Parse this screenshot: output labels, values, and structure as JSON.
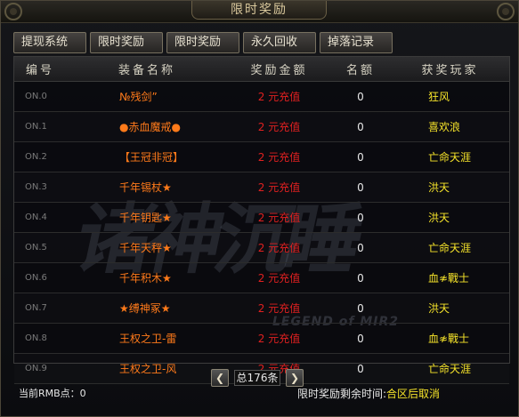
{
  "window": {
    "title": "限时奖励"
  },
  "tabs": [
    {
      "label": "提现系统"
    },
    {
      "label": "限时奖励"
    },
    {
      "label": "限时奖励"
    },
    {
      "label": "永久回收"
    },
    {
      "label": "掉落记录"
    }
  ],
  "table": {
    "headers": {
      "number": "编号",
      "item": "装备名称",
      "reward": "奖励金额",
      "quota": "名额",
      "winner": "获奖玩家"
    },
    "rows": [
      {
        "number": "ON.0",
        "item": "№残剑”",
        "reward": "2 元充值",
        "quota": "0",
        "winner": "狂风"
      },
      {
        "number": "ON.1",
        "item": "●赤血魔戒●",
        "reward": "2 元充值",
        "quota": "0",
        "winner": "喜欢浪"
      },
      {
        "number": "ON.2",
        "item": "【王冠非冠】",
        "reward": "2 元充值",
        "quota": "0",
        "winner": "亡命天涯"
      },
      {
        "number": "ON.3",
        "item": "千年锡杖★",
        "reward": "2 元充值",
        "quota": "0",
        "winner": "洪天"
      },
      {
        "number": "ON.4",
        "item": "千年钥匙★",
        "reward": "2 元充值",
        "quota": "0",
        "winner": "洪天"
      },
      {
        "number": "ON.5",
        "item": "千年天秤★",
        "reward": "2 元充值",
        "quota": "0",
        "winner": "亡命天涯"
      },
      {
        "number": "ON.6",
        "item": "千年积木★",
        "reward": "2 元充值",
        "quota": "0",
        "winner": "血≉戰士"
      },
      {
        "number": "ON.7",
        "item": "★缚神冢★",
        "reward": "2 元充值",
        "quota": "0",
        "winner": "洪天"
      },
      {
        "number": "ON.8",
        "item": "王权之卫-雷",
        "reward": "2 元充值",
        "quota": "0",
        "winner": "血≉戰士"
      },
      {
        "number": "ON.9",
        "item": "王权之卫-风",
        "reward": "2 元充值",
        "quota": "0",
        "winner": "亡命天涯"
      }
    ]
  },
  "watermark": {
    "text": "诸神沉睡",
    "subtext": "LEGEND of MIR2"
  },
  "pager": {
    "prev_icon": "chevron-left-icon",
    "next_icon": "chevron-right-icon",
    "total": "总176条"
  },
  "footer": {
    "rmb_label": "当前RMB点：0",
    "remaining_label": "限时奖励剩余时间:",
    "remaining_value": "合区后取消"
  },
  "colors": {
    "item": "#ff7a1a",
    "reward": "#e02020",
    "winner": "#f5e32a",
    "frame": "#4b4538"
  }
}
